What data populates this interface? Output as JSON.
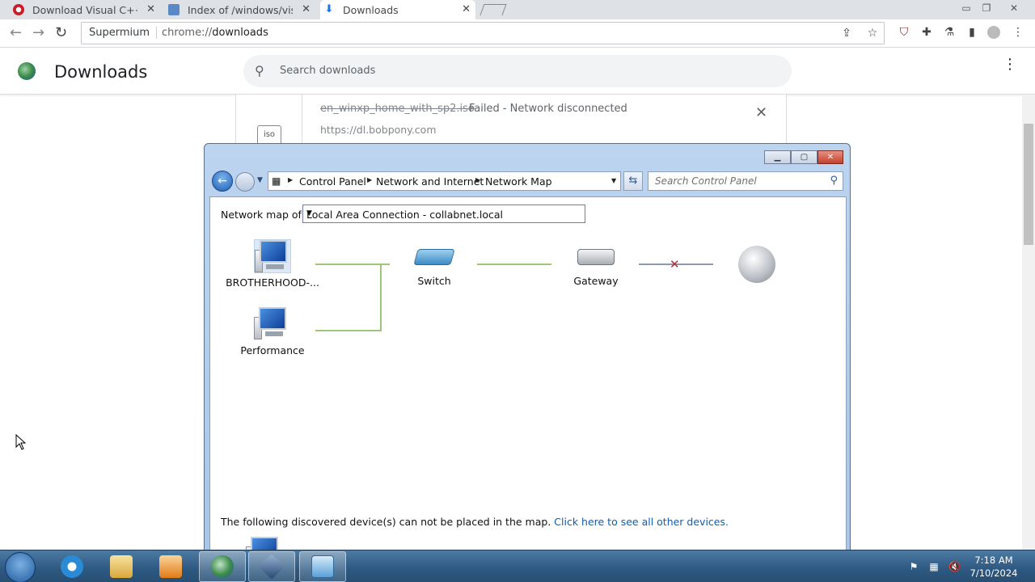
{
  "browser": {
    "tabs": [
      {
        "title": "Download Visual C++ R",
        "active": false
      },
      {
        "title": "Index of /windows/vista",
        "active": false
      },
      {
        "title": "Downloads",
        "active": true
      }
    ],
    "omnibox": {
      "site_chip": "Supermium",
      "url_prefix": "chrome://",
      "url_host": "downloads"
    }
  },
  "downloads": {
    "title": "Downloads",
    "search_placeholder": "Search downloads",
    "item": {
      "file_icon_label": "iso",
      "filename": "en_winxp_home_with_sp2.iso",
      "status": "Failed - Network disconnected",
      "url": "https://dl.bobpony.com"
    }
  },
  "dialog": {
    "breadcrumb": [
      "Control Panel",
      "Network and Internet",
      "Network Map"
    ],
    "search_placeholder": "Search Control Panel",
    "map_label": "Network map of",
    "connection": "Local Area Connection - collabnet.local",
    "devices": {
      "pc1": "BROTHERHOOD-...",
      "pc2": "Performance",
      "switch": "Switch",
      "gateway": "Gateway"
    },
    "footer_text": "The following discovered device(s) can not be placed in the map.",
    "footer_link": "Click here to see all other devices."
  },
  "taskbar": {
    "time": "7:18 AM",
    "date": "7/10/2024"
  },
  "colors": {
    "link": "#0a5fb4",
    "map_line": "#9bc87a",
    "disconnect_x": "#c0262e"
  }
}
